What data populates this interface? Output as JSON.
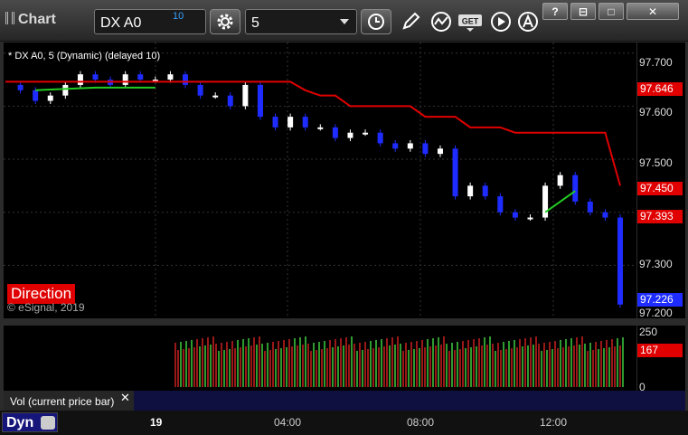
{
  "toolbar": {
    "app_title": "Chart",
    "symbol": "DX A0",
    "symbol_superscript": "10",
    "interval": "5",
    "window_buttons": [
      "?",
      "⊟",
      "□",
      "✕"
    ]
  },
  "chart": {
    "title": "* DX A0, 5 (Dynamic) (delayed 10)",
    "direction_label": "Direction",
    "watermark": "© eSignal, 2019",
    "price_axis": [
      "97.700",
      "97.600",
      "97.500",
      "97.300",
      "97.200"
    ],
    "badges": {
      "red_line": "97.646",
      "lower_line": "97.450",
      "prev": "97.393",
      "last": "97.226"
    },
    "volume_axis": [
      "250",
      "0"
    ],
    "volume_badge": "167",
    "volume_label": "Vol (current price bar)",
    "volume_close": "✕",
    "time_labels": [
      "19",
      "04:00",
      "08:00",
      "12:00"
    ],
    "dyn_label": "Dyn",
    "colors": {
      "up": "#ffffff",
      "down": "#1e2cff",
      "red": "#e00000",
      "green": "#22cc22",
      "vol_up": "#3fcf3f",
      "vol_down": "#cc2020"
    }
  },
  "chart_data": {
    "type": "candlestick",
    "ylim": [
      97.2,
      97.72
    ],
    "close_points": [
      97.64,
      97.63,
      97.61,
      97.62,
      97.64,
      97.66,
      97.65,
      97.64,
      97.66,
      97.65,
      97.65,
      97.66,
      97.64,
      97.62,
      97.62,
      97.6,
      97.64,
      97.58,
      97.56,
      97.58,
      97.56,
      97.56,
      97.54,
      97.55,
      97.55,
      97.53,
      97.52,
      97.53,
      97.51,
      97.52,
      97.43,
      97.45,
      97.43,
      97.4,
      97.39,
      97.39,
      97.45,
      97.47,
      97.42,
      97.4,
      97.39,
      97.226
    ],
    "red_line": [
      97.646,
      97.646,
      97.646,
      97.646,
      97.646,
      97.646,
      97.646,
      97.646,
      97.646,
      97.646,
      97.646,
      97.646,
      97.646,
      97.646,
      97.646,
      97.646,
      97.646,
      97.646,
      97.646,
      97.646,
      97.63,
      97.62,
      97.62,
      97.6,
      97.6,
      97.6,
      97.6,
      97.6,
      97.58,
      97.58,
      97.58,
      97.56,
      97.56,
      97.56,
      97.55,
      97.55,
      97.55,
      97.55,
      97.55,
      97.55,
      97.55,
      97.45
    ]
  }
}
